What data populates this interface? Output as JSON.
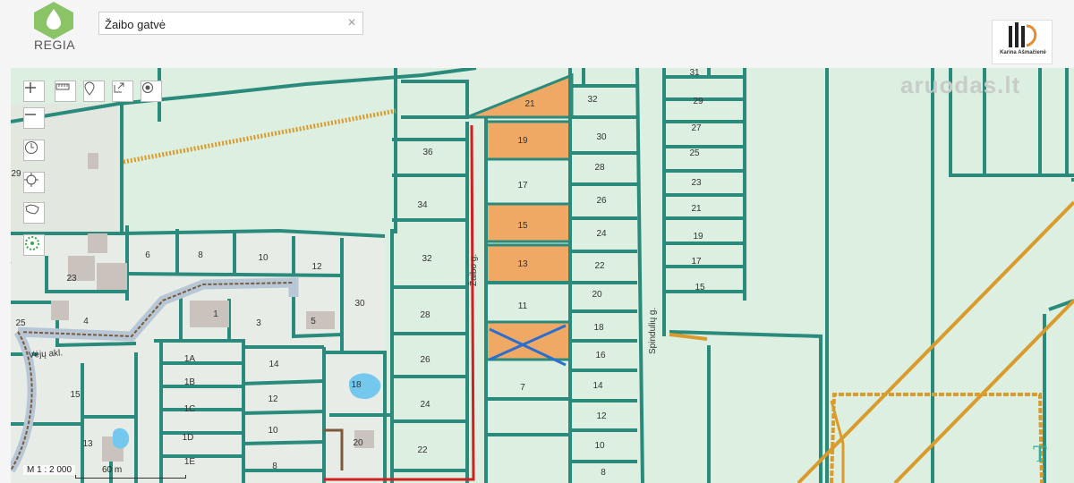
{
  "app": {
    "logo_text": "REGIA",
    "brand_name": "Karina Ašmačienė",
    "watermark": "aruodas.lt"
  },
  "search": {
    "value": "Žaibo gatvė",
    "clear_label": "×"
  },
  "toolbar": {
    "top": [
      "zoom-in-icon",
      "ruler-icon",
      "pin-icon",
      "share-icon",
      "target-icon"
    ],
    "zoom_out": "zoom-out-icon",
    "side": [
      "clock-icon",
      "locate-icon",
      "lithuania-map-icon",
      "layers-icon"
    ]
  },
  "map": {
    "scale": "M 1 : 2 000",
    "scale_length": "60 m",
    "streets": {
      "zaibo": "Žaibo g.",
      "spinduliu": "Spindulių g.",
      "veju": "Vėjų akl."
    },
    "plots": {
      "col_a": [
        "36",
        "34",
        "32",
        "28",
        "26",
        "24",
        "22"
      ],
      "col_b": [
        "21",
        "19",
        "17",
        "15",
        "13",
        "11",
        "7"
      ],
      "col_c": [
        "32",
        "30",
        "28",
        "26",
        "24",
        "22",
        "20",
        "18",
        "16",
        "14",
        "12",
        "10",
        "8"
      ],
      "col_d": [
        "31",
        "29",
        "27",
        "25",
        "23",
        "21",
        "19",
        "17",
        "15"
      ],
      "west": [
        "6",
        "8",
        "10",
        "12",
        "23",
        "4",
        "1",
        "3",
        "5",
        "30",
        "25",
        "1A",
        "1B",
        "1C",
        "1D",
        "1E",
        "14",
        "12",
        "10",
        "8",
        "18",
        "20",
        "15",
        "13",
        "29",
        "7"
      ]
    },
    "highlighted": [
      "21",
      "19",
      "15",
      "13"
    ]
  },
  "colors": {
    "plot_fill": "#dcefe0",
    "boundary": "#2a8a7c",
    "highlight": "#f0a965",
    "road": "#d99b2b",
    "red_line": "#d12020",
    "building": "#c9c2bd"
  }
}
